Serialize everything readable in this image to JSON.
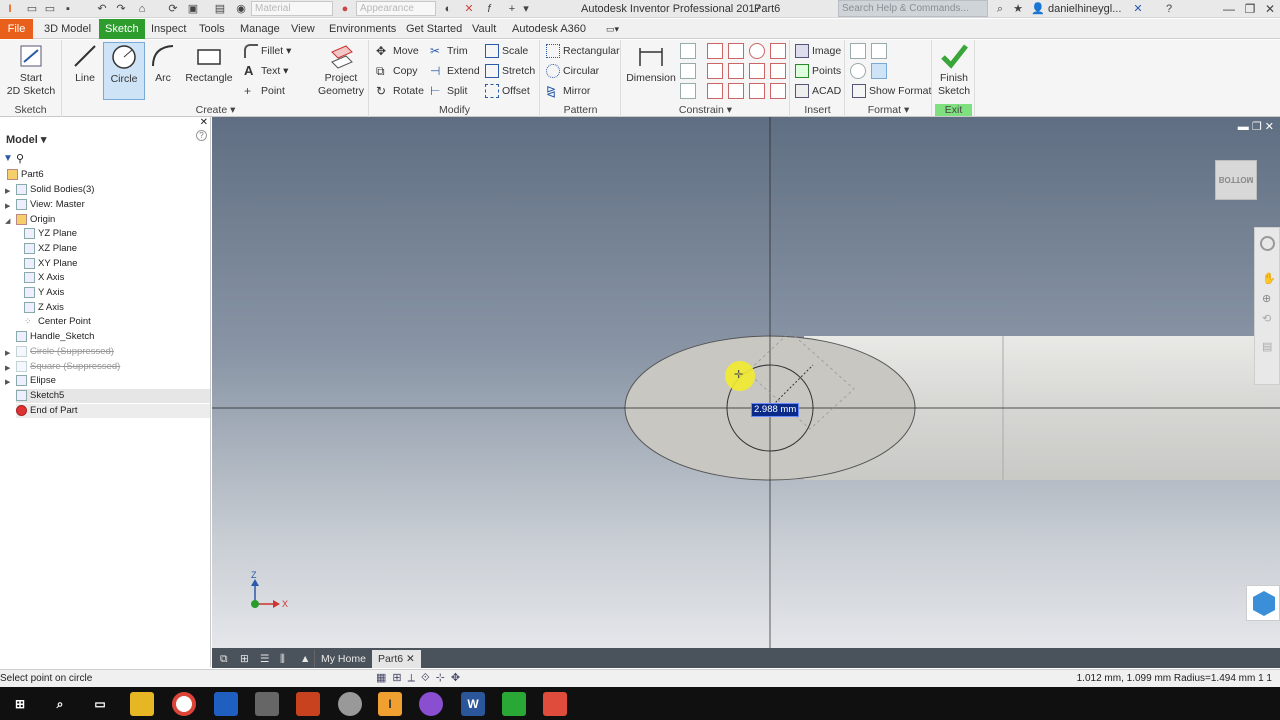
{
  "window": {
    "app_title": "Autodesk Inventor Professional 2017",
    "doc_title": "Part6",
    "material_placeholder": "Material",
    "appearance_placeholder": "Appearance",
    "search_placeholder": "Search Help & Commands...",
    "user_name": "danielhineygl...",
    "minimize": "—",
    "restore": "❐",
    "close": "✕"
  },
  "tabs": {
    "file": "File",
    "model3d": "3D Model",
    "sketch": "Sketch",
    "inspect": "Inspect",
    "tools": "Tools",
    "manage": "Manage",
    "view": "View",
    "environments": "Environments",
    "get_started": "Get Started",
    "vault": "Vault",
    "a360": "Autodesk A360"
  },
  "ribbon": {
    "sketch": {
      "start_line1": "Start",
      "start_line2": "2D Sketch",
      "label": "Sketch"
    },
    "create": {
      "line": "Line",
      "circle": "Circle",
      "arc": "Arc",
      "rectangle": "Rectangle",
      "fillet": "Fillet",
      "text": "Text",
      "point": "Point",
      "project_line1": "Project",
      "project_line2": "Geometry",
      "label": "Create"
    },
    "modify": {
      "move": "Move",
      "copy": "Copy",
      "rotate": "Rotate",
      "trim": "Trim",
      "extend": "Extend",
      "split": "Split",
      "scale": "Scale",
      "stretch": "Stretch",
      "offset": "Offset",
      "label": "Modify"
    },
    "pattern": {
      "rectangular": "Rectangular",
      "circular": "Circular",
      "mirror": "Mirror",
      "label": "Pattern"
    },
    "constrain": {
      "dimension": "Dimension",
      "label": "Constrain"
    },
    "insert": {
      "image": "Image",
      "points": "Points",
      "acad": "ACAD",
      "label": "Insert"
    },
    "format": {
      "show_format": "Show Format",
      "label": "Format"
    },
    "exit": {
      "finish_line1": "Finish",
      "finish_line2": "Sketch",
      "label": "Exit"
    }
  },
  "browser": {
    "title": "Model",
    "items": [
      {
        "label": "Part6"
      },
      {
        "label": "Solid Bodies(3)"
      },
      {
        "label": "View: Master"
      },
      {
        "label": "Origin"
      },
      {
        "label": "YZ Plane"
      },
      {
        "label": "XZ Plane"
      },
      {
        "label": "XY Plane"
      },
      {
        "label": "X Axis"
      },
      {
        "label": "Y Axis"
      },
      {
        "label": "Z Axis"
      },
      {
        "label": "Center Point"
      },
      {
        "label": "Handle_Sketch"
      },
      {
        "label": "Circle (Suppressed)"
      },
      {
        "label": "Square (Suppressed)"
      },
      {
        "label": "Elipse"
      },
      {
        "label": "Sketch5"
      },
      {
        "label": "End of Part"
      }
    ]
  },
  "viewport": {
    "dimension_value": "2.988 mm",
    "viewcube_face": "BOTTOM",
    "axis_x": "X",
    "axis_z": "Z"
  },
  "doc_tabs": {
    "home": "My Home",
    "part": "Part6",
    "close": "✕"
  },
  "status": {
    "message": "Select point on circle",
    "coords": "1.012 mm, 1.099 mm Radius=1.494 mm   1     1"
  },
  "taskbar": {
    "word": "W"
  }
}
